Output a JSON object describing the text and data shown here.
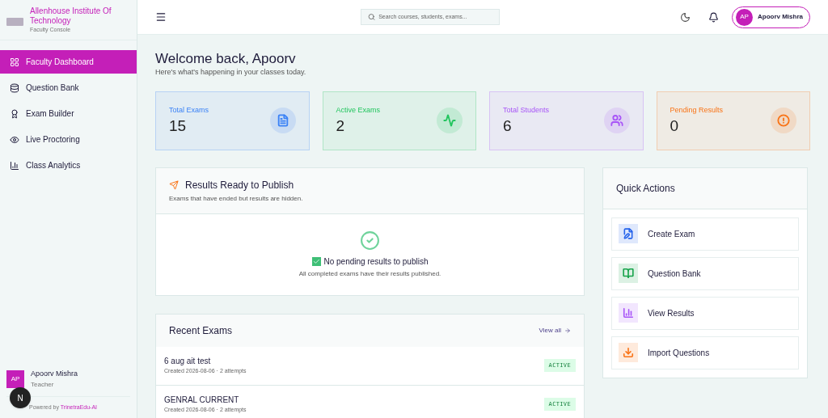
{
  "sidebar": {
    "brand": {
      "name": "Allenhouse Institute Of Technology",
      "subtitle": "Faculty Console"
    },
    "items": [
      {
        "label": "Faculty Dashboard",
        "kind": "grid",
        "selected": true
      },
      {
        "label": "Question Bank",
        "kind": "database",
        "selected": false
      },
      {
        "label": "Exam Builder",
        "kind": "award",
        "selected": false
      },
      {
        "label": "Live Proctoring",
        "kind": "eye",
        "selected": false
      },
      {
        "label": "Class Analytics",
        "kind": "chart",
        "selected": false
      }
    ],
    "user": {
      "initials": "AP",
      "name": "Apoorv Mishra",
      "role": "Teacher"
    },
    "floating_badge": "N",
    "footer": {
      "prefix": "Powered by",
      "link": "TrinetraEdu-AI"
    }
  },
  "topbar": {
    "search": {
      "placeholder": "Search courses, students, exams..."
    },
    "user": {
      "initials": "AP",
      "name": "Apoorv Mishra"
    }
  },
  "welcome": {
    "title": "Welcome back, Apoorv",
    "subtitle": "Here's what's happening in your classes today."
  },
  "stats": [
    {
      "label": "Total Exams",
      "value": "15",
      "kind": "document",
      "color": "#3b82f6"
    },
    {
      "label": "Active Exams",
      "value": "2",
      "kind": "activity",
      "color": "#22c55e"
    },
    {
      "label": "Total Students",
      "value": "6",
      "kind": "users",
      "color": "#a855f7"
    },
    {
      "label": "Pending Results",
      "value": "0",
      "kind": "alert",
      "color": "#f97316"
    }
  ],
  "results_panel": {
    "title": "Results Ready to Publish",
    "subtitle": "Exams that have ended but results are hidden.",
    "empty_title": "No pending results to publish",
    "empty_text": "All completed exams have their results published."
  },
  "recent_exams": {
    "title": "Recent Exams",
    "view_all": "View all",
    "rows": [
      {
        "name": "6 aug ait test",
        "meta": "Created 2026-08-06 · 2 attempts",
        "status": "ACTIVE"
      },
      {
        "name": "GENRAL CURRENT",
        "meta": "Created 2026-08-06 · 2 attempts",
        "status": "ACTIVE"
      }
    ]
  },
  "quick_actions": {
    "title": "Quick Actions",
    "items": [
      {
        "label": "Create Exam",
        "kind": "file-edit",
        "color": "#2563eb"
      },
      {
        "label": "Question Bank",
        "kind": "book",
        "color": "#16a34a"
      },
      {
        "label": "View Results",
        "kind": "chart",
        "color": "#a855f7"
      },
      {
        "label": "Import Questions",
        "kind": "download",
        "color": "#f97316"
      }
    ]
  }
}
